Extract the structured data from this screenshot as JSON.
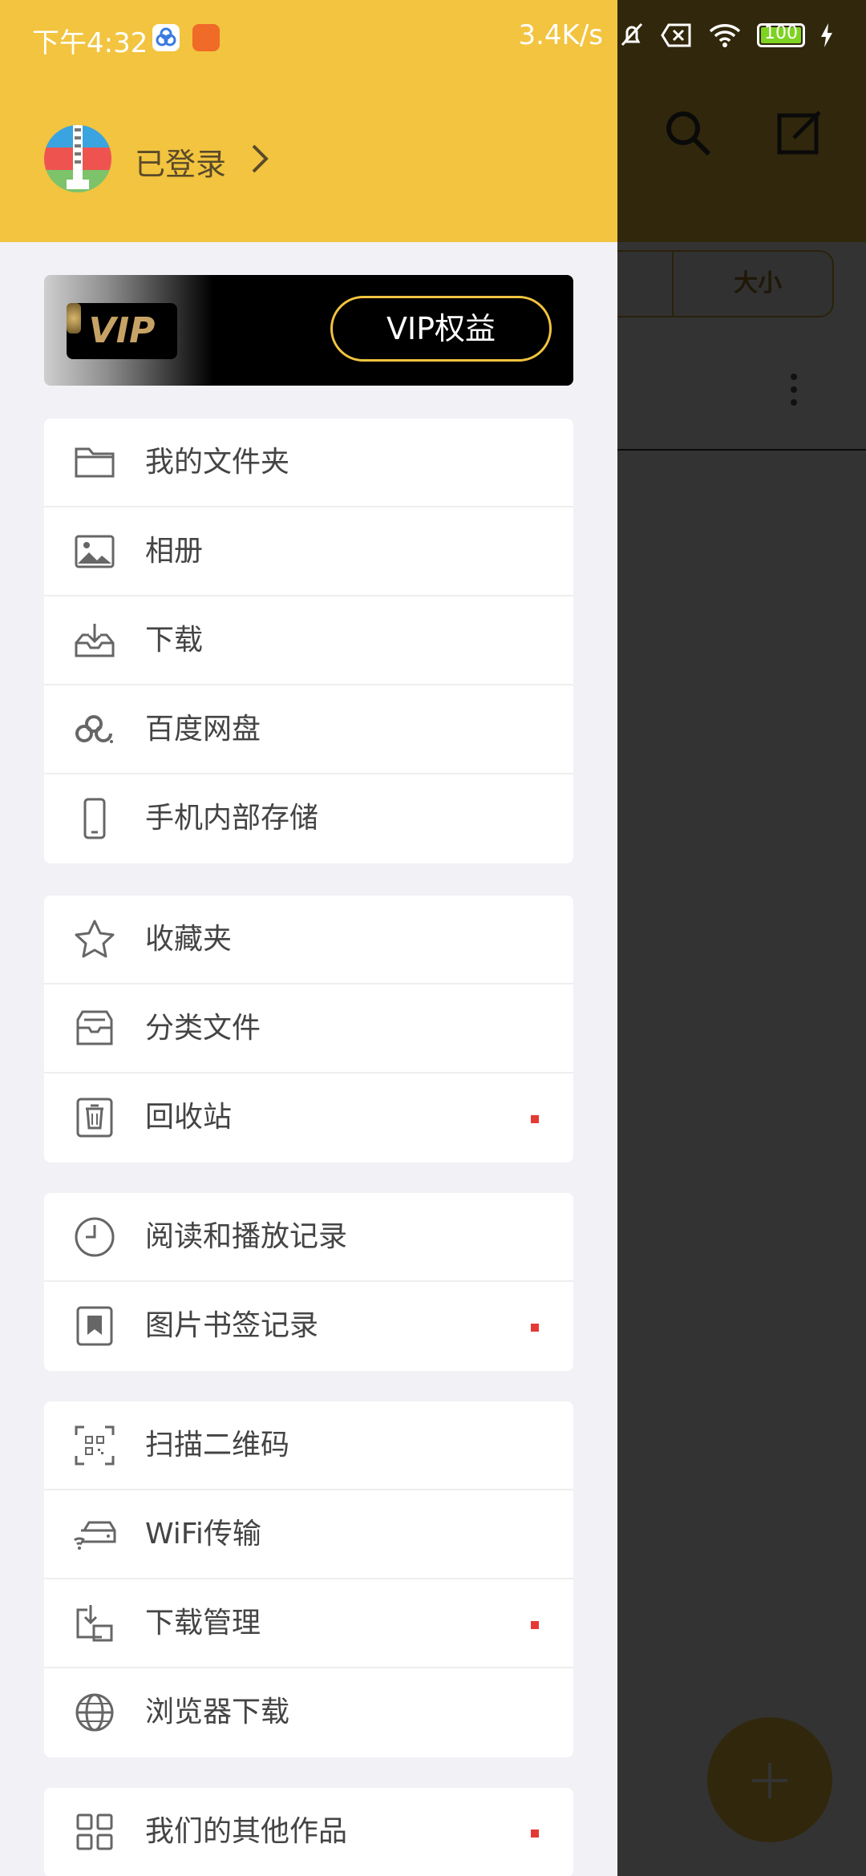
{
  "status_bar": {
    "time": "下午4:32",
    "net_speed": "3.4K/s",
    "battery": "100"
  },
  "drawer": {
    "header": {
      "login_text": "已登录"
    },
    "vip": {
      "badge": "VIP",
      "button_label": "VIP权益"
    },
    "groups": [
      {
        "items": [
          {
            "label": "我的文件夹",
            "icon": "folder-icon",
            "badge": false
          },
          {
            "label": "相册",
            "icon": "image-icon",
            "badge": false
          },
          {
            "label": "下载",
            "icon": "inbox-download-icon",
            "badge": false
          },
          {
            "label": "百度网盘",
            "icon": "baidu-cloud-icon",
            "badge": false
          },
          {
            "label": "手机内部存储",
            "icon": "phone-icon",
            "badge": false
          }
        ]
      },
      {
        "items": [
          {
            "label": "收藏夹",
            "icon": "star-icon",
            "badge": false
          },
          {
            "label": "分类文件",
            "icon": "category-box-icon",
            "badge": false
          },
          {
            "label": "回收站",
            "icon": "trash-icon",
            "badge": true
          }
        ]
      },
      {
        "items": [
          {
            "label": "阅读和播放记录",
            "icon": "clock-icon",
            "badge": false
          },
          {
            "label": "图片书签记录",
            "icon": "bookmark-icon",
            "badge": true
          }
        ]
      },
      {
        "items": [
          {
            "label": "扫描二维码",
            "icon": "qr-scan-icon",
            "badge": false
          },
          {
            "label": "WiFi传输",
            "icon": "wifi-transfer-icon",
            "badge": false
          },
          {
            "label": "下载管理",
            "icon": "download-manage-icon",
            "badge": true
          },
          {
            "label": "浏览器下载",
            "icon": "globe-icon",
            "badge": false
          }
        ]
      },
      {
        "items": [
          {
            "label": "我们的其他作品",
            "icon": "apps-grid-icon",
            "badge": true
          }
        ]
      }
    ]
  },
  "background": {
    "sort_size_label": "大小"
  },
  "colors": {
    "accent": "#f2c43f",
    "badge_red": "#e53935"
  }
}
